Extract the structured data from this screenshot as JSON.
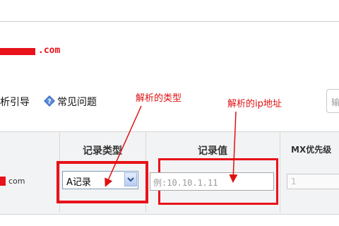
{
  "header": {
    "domain_suffix": ".com"
  },
  "links": {
    "guide": "析引导",
    "faq": "常见问题"
  },
  "search": {
    "placeholder": "输"
  },
  "annotations": {
    "record_type": "解析的类型",
    "ip_address": "解析的ip地址"
  },
  "table": {
    "columns": [
      "记录类型",
      "记录值",
      "MX优先级"
    ],
    "row": {
      "host_suffix": "com",
      "record_type": "A记录",
      "record_value_placeholder": "例:10.10.1.11",
      "mx_priority": "1"
    }
  },
  "colors": {
    "annotation": "#e01010",
    "redaction": "#e8121a"
  },
  "icons": [
    "question-diamond-icon",
    "chevron-down-icon"
  ]
}
